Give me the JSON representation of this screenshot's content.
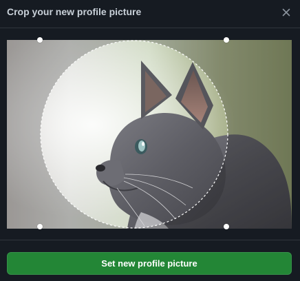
{
  "dialog": {
    "title": "Crop your new profile picture",
    "close_icon": "close-icon"
  },
  "crop": {
    "image_subject": "gray cat profile photo",
    "handles": [
      "crop-handle-top-left",
      "crop-handle-top-right",
      "crop-handle-bottom-left",
      "crop-handle-bottom-right"
    ]
  },
  "footer": {
    "submit_label": "Set new profile picture"
  },
  "colors": {
    "background": "#161b22",
    "border": "#30363d",
    "title_text": "#c9d1d9",
    "primary_button": "#238636",
    "button_text": "#ffffff"
  }
}
